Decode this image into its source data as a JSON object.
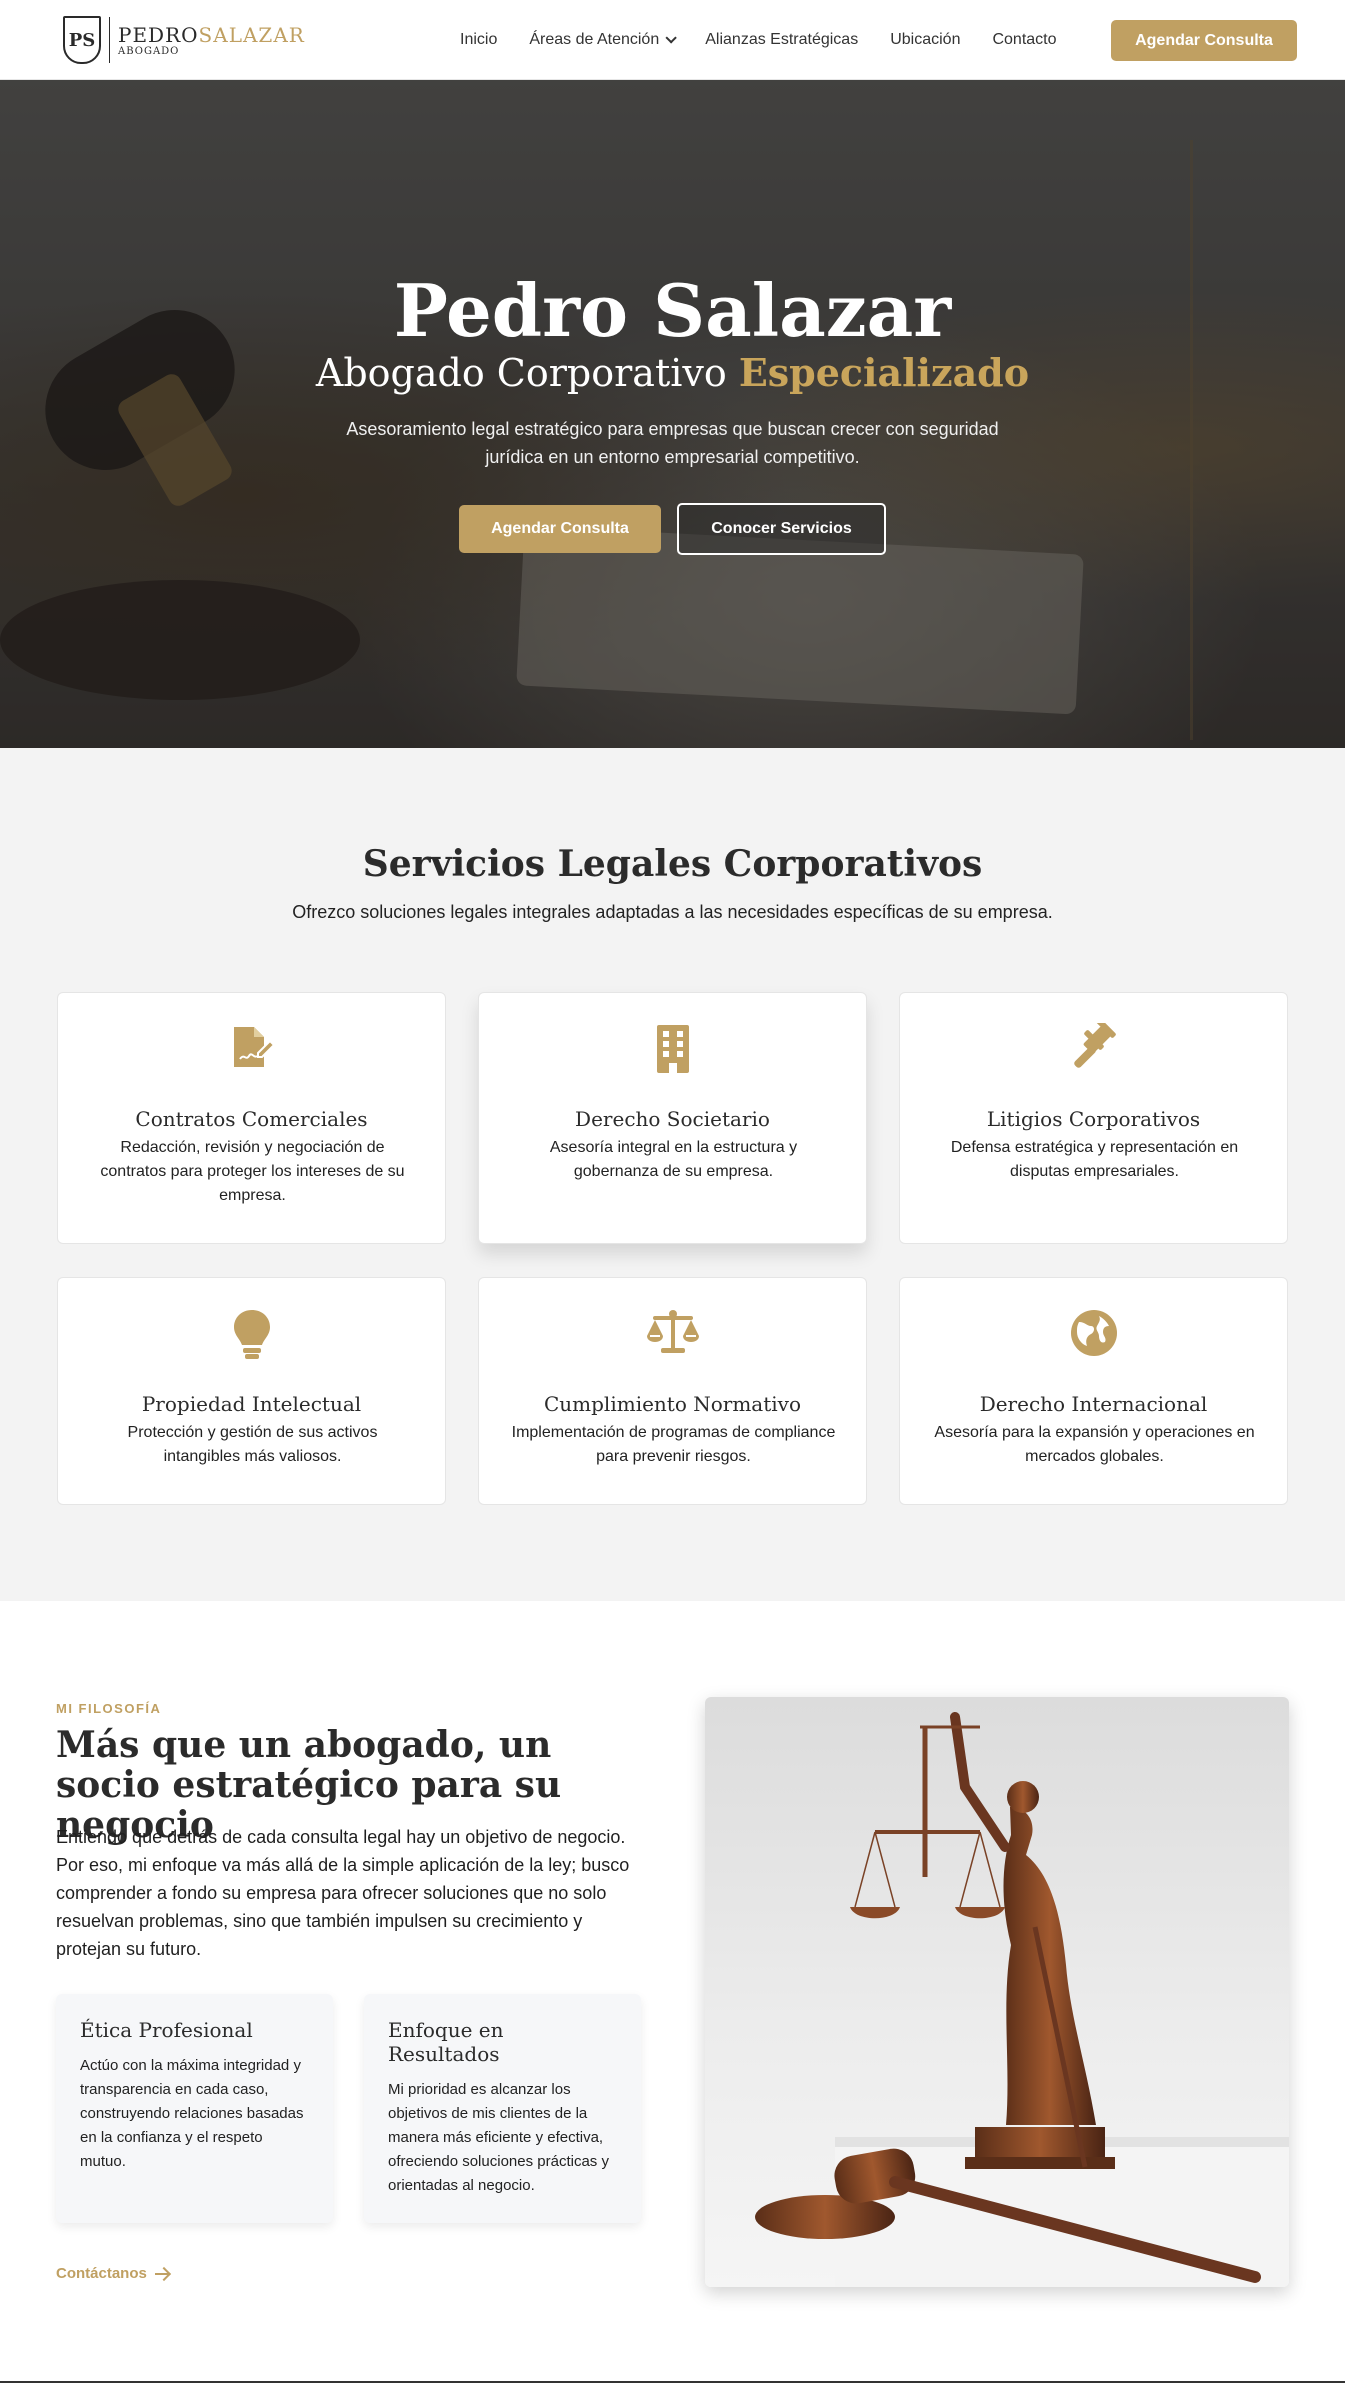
{
  "header": {
    "logo": {
      "monogram": "PS",
      "first": "PEDRO",
      "last": "SALAZAR",
      "subtitle": "ABOGADO"
    },
    "nav": [
      {
        "label": "Inicio"
      },
      {
        "label": "Áreas de Atención",
        "dropdown": true
      },
      {
        "label": "Alianzas Estratégicas"
      },
      {
        "label": "Ubicación"
      },
      {
        "label": "Contacto"
      }
    ],
    "cta": "Agendar Consulta"
  },
  "hero": {
    "title": "Pedro Salazar",
    "subtitle_a": "Abogado Corporativo",
    "subtitle_b": "Especializado",
    "description": "Asesoramiento legal estratégico para empresas que buscan crecer con seguridad jurídica en un entorno empresarial competitivo.",
    "primary_button": "Agendar Consulta",
    "secondary_button": "Conocer Servicios"
  },
  "services": {
    "title": "Servicios Legales Corporativos",
    "description": "Ofrezco soluciones legales integrales adaptadas a las necesidades específicas de su empresa.",
    "items": [
      {
        "icon": "file-contract-icon",
        "title": "Contratos Comerciales",
        "description": "Redacción, revisión y negociación de contratos para proteger los intereses de su empresa."
      },
      {
        "icon": "building-icon",
        "title": "Derecho Societario",
        "description": "Asesoría integral en la estructura y gobernanza de su empresa."
      },
      {
        "icon": "gavel-icon",
        "title": "Litigios Corporativos",
        "description": "Defensa estratégica y representación en disputas empresariales."
      },
      {
        "icon": "lightbulb-icon",
        "title": "Propiedad Intelectual",
        "description": "Protección y gestión de sus activos intangibles más valiosos."
      },
      {
        "icon": "balance-scale-icon",
        "title": "Cumplimiento Normativo",
        "description": "Implementación de programas de compliance para prevenir riesgos."
      },
      {
        "icon": "globe-icon",
        "title": "Derecho Internacional",
        "description": "Asesoría para la expansión y operaciones en mercados globales."
      }
    ]
  },
  "philosophy": {
    "eyebrow": "MI FILOSOFÍA",
    "title": "Más que un abogado, un socio estratégico para su negocio",
    "body": "Entiendo que detrás de cada consulta legal hay un objetivo de negocio. Por eso, mi enfoque va más allá de la simple aplicación de la ley; busco comprender a fondo su empresa para ofrecer soluciones que no solo resuelvan problemas, sino que también impulsen su crecimiento y protejan su futuro.",
    "values": [
      {
        "title": "Ética Profesional",
        "description": "Actúo con la máxima integridad y transparencia en cada caso, construyendo relaciones basadas en la confianza y el respeto mutuo."
      },
      {
        "title": "Enfoque en Resultados",
        "description": "Mi prioridad es alcanzar los objetivos de mis clientes de la manera más eficiente y efectiva, ofreciendo soluciones prácticas y orientadas al negocio."
      }
    ],
    "link": "Contáctanos"
  },
  "colors": {
    "accent": "#c0a062",
    "text": "#2b2b2b",
    "section_bg": "#f3f3f3"
  }
}
